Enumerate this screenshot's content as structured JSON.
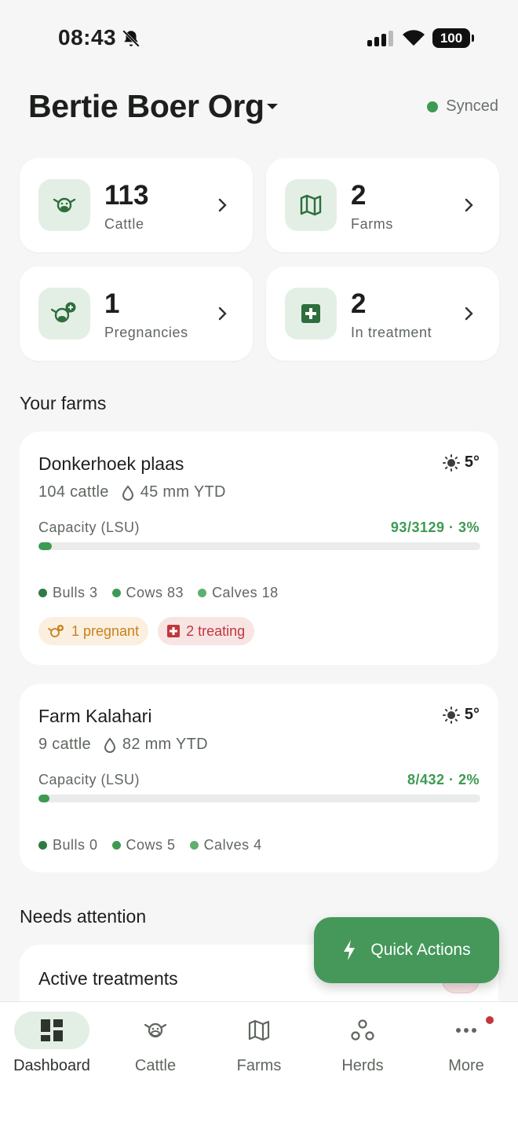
{
  "status_bar": {
    "time": "08:43",
    "battery": "100"
  },
  "header": {
    "org_name": "Bertie Boer Org",
    "sync_status": "Synced"
  },
  "stats": [
    {
      "value": "113",
      "label": "Cattle",
      "icon": "cow-icon"
    },
    {
      "value": "2",
      "label": "Farms",
      "icon": "map-icon"
    },
    {
      "value": "1",
      "label": "Pregnancies",
      "icon": "pregnant-cow-icon"
    },
    {
      "value": "2",
      "label": "In treatment",
      "icon": "medical-cross-icon"
    }
  ],
  "farms_section": {
    "title": "Your farms"
  },
  "farms": [
    {
      "name": "Donkerhoek plaas",
      "temperature": "5°",
      "cattle": "104 cattle",
      "rainfall": "45 mm YTD",
      "capacity_label": "Capacity (LSU)",
      "capacity_value": "93/3129 · 3%",
      "capacity_fraction": 0.03,
      "breakdown": [
        {
          "label": "Bulls 3",
          "color": "#2f7a43"
        },
        {
          "label": "Cows 83",
          "color": "#3d9a52"
        },
        {
          "label": "Calves 18",
          "color": "#5fae72"
        }
      ],
      "tags": {
        "pregnant": "1 pregnant",
        "treating": "2 treating"
      }
    },
    {
      "name": "Farm Kalahari",
      "temperature": "5°",
      "cattle": "9 cattle",
      "rainfall": "82 mm YTD",
      "capacity_label": "Capacity (LSU)",
      "capacity_value": "8/432 · 2%",
      "capacity_fraction": 0.02,
      "breakdown": [
        {
          "label": "Bulls 0",
          "color": "#2f7a43"
        },
        {
          "label": "Cows 5",
          "color": "#3d9a52"
        },
        {
          "label": "Calves 4",
          "color": "#5fae72"
        }
      ]
    }
  ],
  "attention": {
    "title": "Needs attention",
    "card_title": "Active treatments"
  },
  "fab": {
    "label": "Quick Actions"
  },
  "nav": [
    {
      "label": "Dashboard",
      "icon": "dashboard-icon",
      "active": true
    },
    {
      "label": "Cattle",
      "icon": "cow-icon"
    },
    {
      "label": "Farms",
      "icon": "map-icon"
    },
    {
      "label": "Herds",
      "icon": "herds-icon"
    },
    {
      "label": "More",
      "icon": "more-icon",
      "badge": true
    }
  ],
  "colors": {
    "accent": "#3d9a52",
    "danger": "#c0383b",
    "warning": "#c9801c"
  }
}
